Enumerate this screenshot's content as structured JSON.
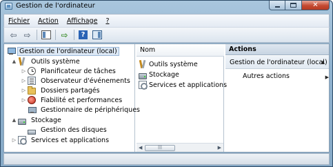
{
  "window": {
    "title": "Gestion de l'ordinateur"
  },
  "menu": {
    "items": [
      "Fichier",
      "Action",
      "Affichage",
      "?"
    ]
  },
  "tree": {
    "items": [
      {
        "label": "Gestion de l'ordinateur (local)",
        "icon": "computer-icon",
        "selected": true
      },
      {
        "label": "Outils système",
        "icon": "tools-icon",
        "expander": "▲"
      },
      {
        "label": "Planificateur de tâches",
        "icon": "clock-icon",
        "expander": "▷"
      },
      {
        "label": "Observateur d'événements",
        "icon": "event-viewer-icon",
        "expander": "▷"
      },
      {
        "label": "Dossiers partagés",
        "icon": "folder-icon",
        "expander": "▷"
      },
      {
        "label": "Fiabilité et performances",
        "icon": "performance-icon",
        "expander": "▷"
      },
      {
        "label": "Gestionnaire de périphériques",
        "icon": "devices-icon"
      },
      {
        "label": "Stockage",
        "icon": "storage-icon",
        "expander": "▲"
      },
      {
        "label": "Gestion des disques",
        "icon": "disk-icon"
      },
      {
        "label": "Services et applications",
        "icon": "services-icon",
        "expander": "▷"
      }
    ]
  },
  "list": {
    "header": "Nom",
    "items": [
      {
        "label": "Outils système",
        "icon": "tools-icon"
      },
      {
        "label": "Stockage",
        "icon": "storage-icon"
      },
      {
        "label": "Services et applications",
        "icon": "services-icon"
      }
    ]
  },
  "actions": {
    "header": "Actions",
    "section": "Gestion de l'ordinateur (local)",
    "more": "Autres actions"
  }
}
